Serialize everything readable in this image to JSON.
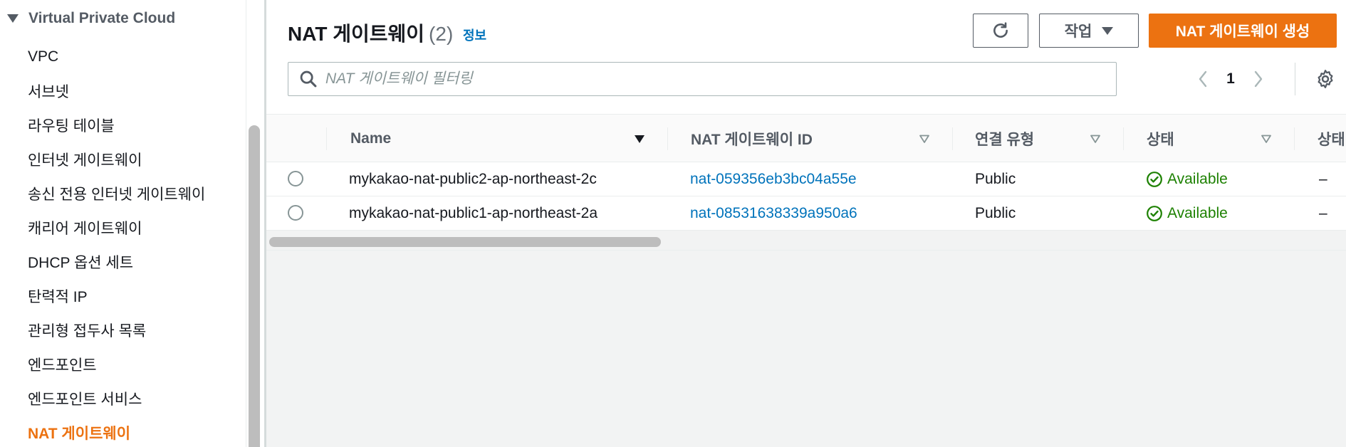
{
  "sidebar": {
    "section_title": "Virtual Private Cloud",
    "items": [
      {
        "label": "VPC"
      },
      {
        "label": "서브넷"
      },
      {
        "label": "라우팅 테이블"
      },
      {
        "label": "인터넷 게이트웨이"
      },
      {
        "label": "송신 전용 인터넷 게이트웨이"
      },
      {
        "label": "캐리어 게이트웨이"
      },
      {
        "label": "DHCP 옵션 세트"
      },
      {
        "label": "탄력적 IP"
      },
      {
        "label": "관리형 접두사 목록"
      },
      {
        "label": "엔드포인트"
      },
      {
        "label": "엔드포인트 서비스"
      },
      {
        "label": "NAT 게이트웨이",
        "active": true
      }
    ]
  },
  "header": {
    "title": "NAT 게이트웨이",
    "count": "(2)",
    "info": "정보",
    "actions_label": "작업",
    "create_label": "NAT 게이트웨이 생성"
  },
  "search": {
    "placeholder": "NAT 게이트웨이 필터링",
    "value": ""
  },
  "pagination": {
    "current_page": "1"
  },
  "table": {
    "columns": [
      "Name",
      "NAT 게이트웨이 ID",
      "연결 유형",
      "상태",
      "상태"
    ],
    "rows": [
      {
        "name": "mykakao-nat-public2-ap-northeast-2c",
        "id": "nat-059356eb3bc04a55e",
        "type": "Public",
        "status": "Available",
        "extra": "–"
      },
      {
        "name": "mykakao-nat-public1-ap-northeast-2a",
        "id": "nat-08531638339a950a6",
        "type": "Public",
        "status": "Available",
        "extra": "–"
      }
    ]
  },
  "colors": {
    "accent": "#ec7211",
    "link": "#0073bb",
    "success": "#1d8102"
  }
}
